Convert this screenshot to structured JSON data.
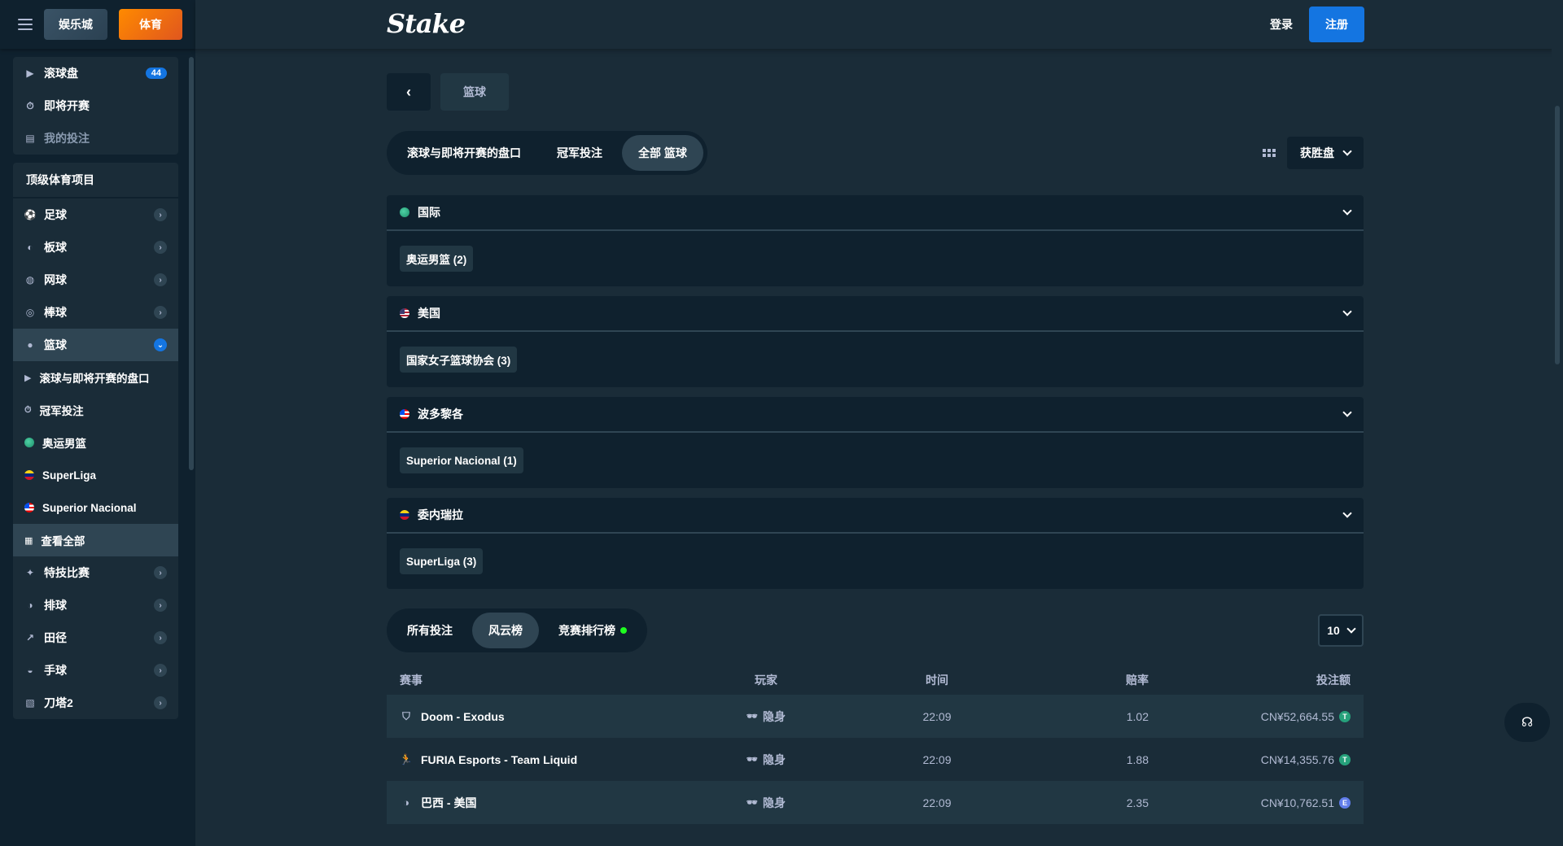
{
  "sidebar": {
    "modes": {
      "casino": "娱乐城",
      "sports": "体育"
    },
    "top_items": [
      {
        "label": "滚球盘",
        "badge": "44"
      },
      {
        "label": "即将开赛"
      },
      {
        "label": "我的投注"
      }
    ],
    "heading": "顶级体育项目",
    "sports": [
      {
        "label": "足球",
        "icon": "soccer-icon"
      },
      {
        "label": "板球",
        "icon": "cricket-icon"
      },
      {
        "label": "网球",
        "icon": "tennis-icon"
      },
      {
        "label": "棒球",
        "icon": "baseball-icon"
      },
      {
        "label": "篮球",
        "icon": "basketball-icon"
      }
    ],
    "basketball_sub": [
      {
        "label": "滚球与即将开赛的盘口"
      },
      {
        "label": "冠军投注"
      },
      {
        "label": "奥运男篮"
      },
      {
        "label": "SuperLiga"
      },
      {
        "label": "Superior Nacional"
      },
      {
        "label": "查看全部"
      }
    ],
    "more_sports": [
      {
        "label": "特技比赛"
      },
      {
        "label": "排球"
      },
      {
        "label": "田径"
      },
      {
        "label": "手球"
      },
      {
        "label": "刀塔2"
      }
    ]
  },
  "header": {
    "logo": "Stake",
    "login": "登录",
    "register": "注册"
  },
  "breadcrumb": {
    "current": "篮球"
  },
  "tabs": [
    "滚球与即将开赛的盘口",
    "冠军投注",
    "全部 篮球"
  ],
  "market_select": "获胜盘",
  "regions": [
    {
      "name": "国际",
      "league": "奥运男篮 (2)"
    },
    {
      "name": "美国",
      "league": "国家女子篮球协会 (3)"
    },
    {
      "name": "波多黎各",
      "league": "Superior Nacional (1)"
    },
    {
      "name": "委内瑞拉",
      "league": "SuperLiga (3)"
    }
  ],
  "bets": {
    "tabs": [
      "所有投注",
      "风云榜",
      "竞赛排行榜"
    ],
    "count": "10",
    "columns": [
      "赛事",
      "玩家",
      "时间",
      "赔率",
      "投注额"
    ],
    "rows": [
      {
        "event": "Doom - Exodus",
        "player": "隐身",
        "time": "22:09",
        "odds": "1.02",
        "amount": "CN¥52,664.55",
        "coin": "T"
      },
      {
        "event": "FURIA Esports - Team Liquid",
        "player": "隐身",
        "time": "22:09",
        "odds": "1.88",
        "amount": "CN¥14,355.76",
        "coin": "T"
      },
      {
        "event": "巴西 - 美国",
        "player": "隐身",
        "time": "22:09",
        "odds": "2.35",
        "amount": "CN¥10,762.51",
        "coin": "E"
      }
    ]
  },
  "colors": {
    "sidebar_bg": "#0f212e",
    "page_bg": "#1a2c38",
    "accent_blue": "#1475e1",
    "sports_orange": "#ff8a00",
    "live_green": "#1fff20"
  }
}
